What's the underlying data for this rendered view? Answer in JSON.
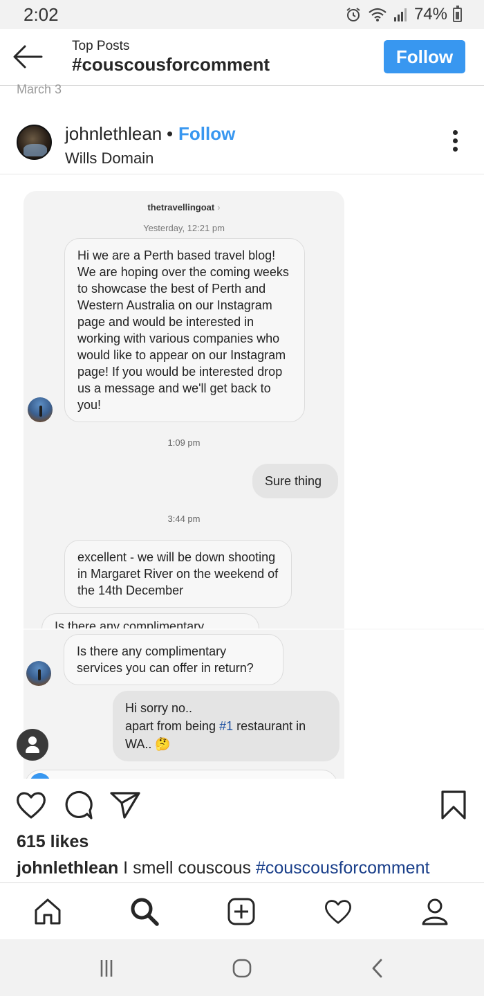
{
  "status_bar": {
    "time": "2:02",
    "battery": "74%",
    "icons": [
      "alarm-icon",
      "wifi-icon",
      "signal-icon",
      "battery-icon"
    ]
  },
  "header": {
    "subtitle": "Top Posts",
    "title": "#couscousforcomment",
    "follow_label": "Follow",
    "back_icon": "back-arrow-icon"
  },
  "previous_post_date": "March 3",
  "post": {
    "username": "johnlethlean",
    "separator": "•",
    "follow_label": "Follow",
    "location": "Wills Domain",
    "more_icon": "more-vertical-icon"
  },
  "dm": {
    "thread_name": "thetravellingoat",
    "chevron": "›",
    "time_1": "Yesterday, 12:21 pm",
    "msg_1": "Hi we are a Perth based travel blog! We are hoping over the coming weeks to showcase the best of Perth and Western Australia on our Instagram page and would be interested in working with various companies who would like to appear on our Instagram page! If you would be interested drop us a message and we'll get back to you!",
    "time_2": "1:09 pm",
    "reply_1": "Sure thing",
    "time_3": "3:44 pm",
    "msg_2": "excellent - we will be down shooting in Margaret River on the weekend of the 14th December",
    "msg_3_cut": "Is there any complimentary",
    "msg_3": "Is there any complimentary services you can offer in return?",
    "reply_2_line1": "Hi sorry no..",
    "reply_2_pre": "apart from being ",
    "reply_2_tag": "#1",
    "reply_2_post": " restaurant in WA..",
    "reply_2_emoji": "🤔"
  },
  "actions": {
    "icons": [
      "heart-icon",
      "comment-icon",
      "share-icon",
      "bookmark-icon"
    ]
  },
  "likes": "615 likes",
  "caption": {
    "user": "johnlethlean",
    "text": " I smell couscous ",
    "tag": "#couscousforcomment"
  },
  "bottom_nav": [
    "home-icon",
    "search-icon",
    "add-post-icon",
    "activity-heart-icon",
    "profile-icon"
  ],
  "android_nav": [
    "recents-icon",
    "home-button-icon",
    "back-icon"
  ]
}
